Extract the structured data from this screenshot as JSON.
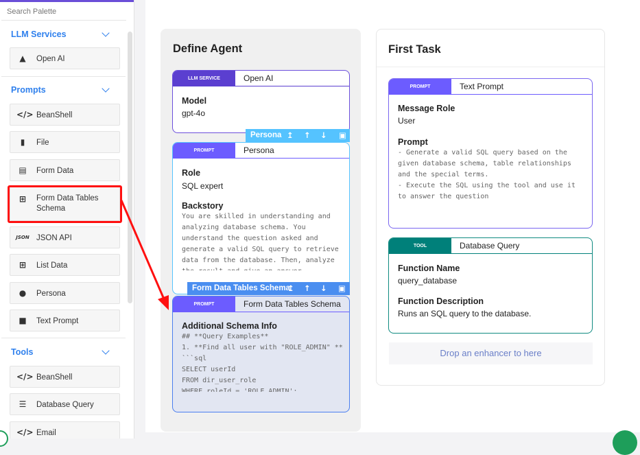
{
  "palette": {
    "search_placeholder": "Search Palette",
    "sections": [
      {
        "title": "LLM Services",
        "items": [
          {
            "label": "Open AI",
            "icon": "spy-icon"
          }
        ]
      },
      {
        "title": "Prompts",
        "items": [
          {
            "label": "BeanShell",
            "icon": "code-icon"
          },
          {
            "label": "File",
            "icon": "file-icon"
          },
          {
            "label": "Form Data",
            "icon": "form-icon"
          },
          {
            "label": "Form Data Tables Schema",
            "icon": "table-icon"
          },
          {
            "label": "JSON API",
            "icon": "json-icon"
          },
          {
            "label": "List Data",
            "icon": "table-icon"
          },
          {
            "label": "Persona",
            "icon": "user-tag-icon"
          },
          {
            "label": "Text Prompt",
            "icon": "comment-icon"
          }
        ]
      },
      {
        "title": "Tools",
        "items": [
          {
            "label": "BeanShell",
            "icon": "code-icon"
          },
          {
            "label": "Database Query",
            "icon": "database-icon"
          },
          {
            "label": "Email",
            "icon": "code-icon"
          }
        ]
      }
    ]
  },
  "define_agent": {
    "title": "Define Agent",
    "llm": {
      "badge": "LLM SERVICE",
      "title": "Open AI",
      "model_label": "Model",
      "model": "gpt-4o"
    },
    "persona_toolbar": "Persona",
    "persona": {
      "badge": "PROMPT",
      "title": "Persona",
      "role_label": "Role",
      "role": "SQL expert",
      "backstory_label": "Backstory",
      "backstory": "You are skilled in understanding and\nanalyzing database schema. You\nunderstand the question asked and\ngenerate a valid SQL query to retrieve\ndata from the database. Then, analyze\nthe result and give an answer"
    },
    "schema_toolbar": "Form Data Tables Schema",
    "schema": {
      "badge": "PROMPT",
      "title": "Form Data Tables Schema",
      "info_label": "Additional Schema Info",
      "info": "## **Query Examples**\n1. **Find all user with \"ROLE_ADMIN\" **\n```sql\nSELECT userId\nFROM dir_user_role\nWHERE roleId = 'ROLE_ADMIN';"
    }
  },
  "first_task": {
    "title": "First Task",
    "prompt": {
      "badge": "PROMPT",
      "title": "Text Prompt",
      "role_label": "Message Role",
      "role": "User",
      "prompt_label": "Prompt",
      "prompt": "- Generate a valid SQL query based on the\ngiven database schema, table relationships\nand the special terms.\n- Execute the SQL using the tool and use it\nto answer the question"
    },
    "tool": {
      "badge": "TOOL",
      "title": "Database Query",
      "fn_label": "Function Name",
      "fn": "query_database",
      "desc_label": "Function Description",
      "desc": "Runs an SQL query to the database."
    },
    "drop": "Drop an enhancer to here"
  },
  "colors": {
    "prompt": "#6c5cff",
    "llm": "#5b3fd0",
    "tool": "#00807a",
    "toolbar": "#55c3ff",
    "toolbar2": "#4a8ef0",
    "highlight": "#ff1010"
  }
}
